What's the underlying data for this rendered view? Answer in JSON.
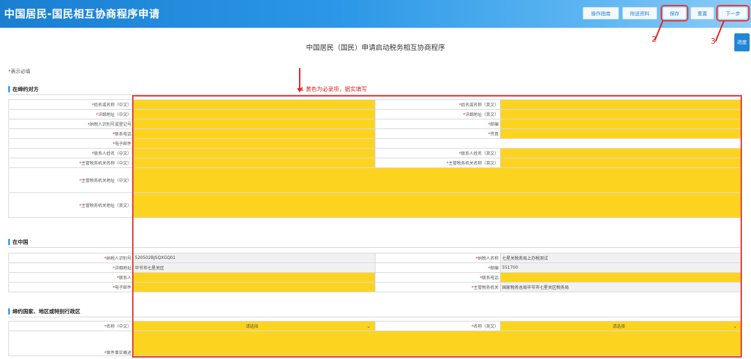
{
  "header": {
    "title": "中国居民-国民相互协商程序申请",
    "buttons": {
      "guide": "操作指南",
      "attachments": "附送资料",
      "save": "保存",
      "reset": "重置",
      "next": "下一步"
    }
  },
  "side": {
    "progress": "进度"
  },
  "annotations": {
    "n1_hint": "1 黄色为必录项，据实填写",
    "n2": "2",
    "n3": "3"
  },
  "page": {
    "title": "中国居民（国民）申请启动税务相互协商程序",
    "required_note": "*表示必填"
  },
  "sections": {
    "treaty_party": "在缔约对方",
    "in_china": "在中国",
    "treaty_country": "缔约国家、地区或特别行政区"
  },
  "treaty_party": {
    "name_cn": "姓名或名称（中文）",
    "name_en": "姓名或名称（英文）",
    "addr_cn": "详细地址（中文）",
    "addr_en": "详细地址（英文）",
    "taxpayer_id": "纳税人识别号或登记号",
    "postcode": "邮编",
    "phone": "联系电话",
    "fax": "传真",
    "email": "电子邮件",
    "contact_cn": "联系人姓名（中文）",
    "contact_en": "联系人姓名（英文）",
    "authority_cn": "主管税务机关名称（中文）",
    "authority_en": "主管税务机关名称（英文）",
    "authority_addr_cn": "主管税务机关地址（中文）",
    "authority_addr_en": "主管税务机关地址（英文）"
  },
  "in_china": {
    "taxpayer_id_label": "纳税人识别号",
    "taxpayer_id_value": "520502BJSQXGQ01",
    "taxpayer_name_label": "纳税人名称",
    "taxpayer_name_value": "七星关税务局上办税测试",
    "address_label": "详细地址",
    "address_value": "毕节市七星关区",
    "postcode_label": "邮编",
    "postcode_value": "551700",
    "contact_label": "联系人",
    "phone_label": "联系电话",
    "email_label": "电子邮件",
    "authority_label": "主管税务机关",
    "authority_value": "国家税务总局毕节市七星关区税务局"
  },
  "treaty_country": {
    "name_cn_label": "名称（中文）",
    "name_cn_value": "请选择",
    "name_en_label": "名称（英文）",
    "name_en_value": "请选择",
    "facts_label": "案件事实概述"
  },
  "colors": {
    "accent": "#1f86d8",
    "required_fill": "#fcd420",
    "annotation": "#e02020"
  }
}
